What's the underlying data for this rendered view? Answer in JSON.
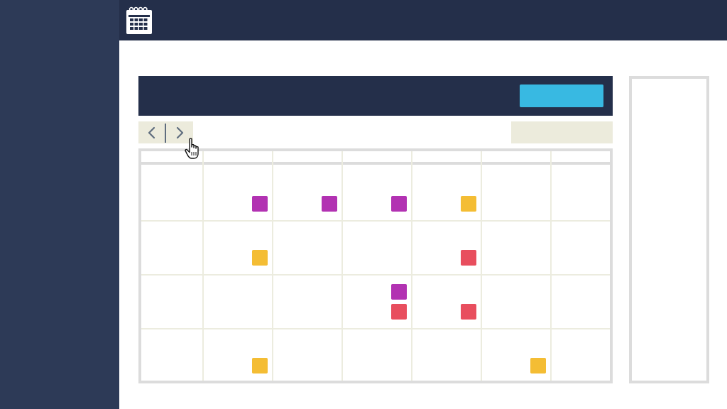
{
  "app": {
    "icon": "calendar-icon"
  },
  "colors": {
    "sidebar": "#2d3a57",
    "topbar": "#242f4a",
    "accent": "#38b9e2",
    "control_bg": "#ecebdc",
    "grid_border": "#dcdcdc",
    "grid_line": "#ececdf",
    "event_purple": "#b232b2",
    "event_yellow": "#f4bd34",
    "event_red": "#e84e5e"
  },
  "toolbar": {
    "primary_button_label": "",
    "prev_icon": "chevron-left-icon",
    "next_icon": "chevron-right-icon",
    "view_select_value": ""
  },
  "calendar": {
    "columns": 7,
    "weeks": 4,
    "events": [
      {
        "week": 1,
        "day": 2,
        "color": "purple"
      },
      {
        "week": 1,
        "day": 3,
        "color": "purple"
      },
      {
        "week": 1,
        "day": 4,
        "color": "purple"
      },
      {
        "week": 1,
        "day": 5,
        "color": "yellow"
      },
      {
        "week": 2,
        "day": 2,
        "color": "yellow"
      },
      {
        "week": 2,
        "day": 5,
        "color": "red"
      },
      {
        "week": 3,
        "day": 4,
        "color": "purple"
      },
      {
        "week": 3,
        "day": 4,
        "color": "red"
      },
      {
        "week": 3,
        "day": 5,
        "color": "red"
      },
      {
        "week": 4,
        "day": 2,
        "color": "yellow"
      },
      {
        "week": 4,
        "day": 6,
        "color": "yellow"
      }
    ]
  },
  "cursor": {
    "icon": "hand-pointer-icon"
  }
}
